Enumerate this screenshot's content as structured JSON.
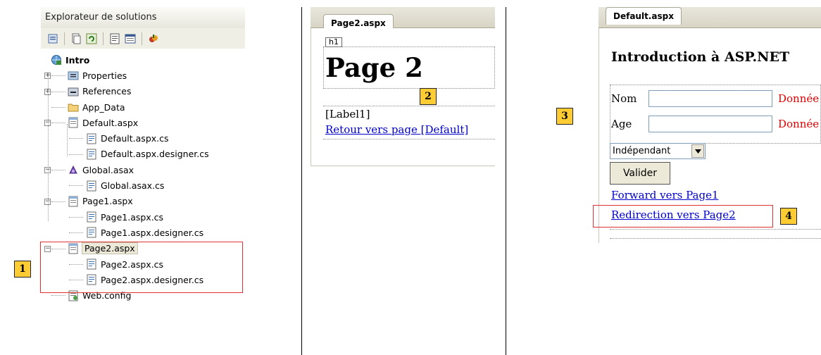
{
  "solution_explorer": {
    "title": "Explorateur de solutions",
    "toolbar_icons": [
      "properties-icon",
      "show-all-files-icon",
      "refresh-icon",
      "view-code-icon",
      "view-designer-icon",
      "class-view-icon"
    ],
    "project": "Intro",
    "items": [
      {
        "label": "Properties"
      },
      {
        "label": "References"
      },
      {
        "label": "App_Data"
      },
      {
        "label": "Default.aspx"
      },
      {
        "label": "Default.aspx.cs"
      },
      {
        "label": "Default.aspx.designer.cs"
      },
      {
        "label": "Global.asax"
      },
      {
        "label": "Global.asax.cs"
      },
      {
        "label": "Page1.aspx"
      },
      {
        "label": "Page1.aspx.cs"
      },
      {
        "label": "Page1.aspx.designer.cs"
      },
      {
        "label": "Page2.aspx"
      },
      {
        "label": "Page2.aspx.cs"
      },
      {
        "label": "Page2.aspx.designer.cs"
      },
      {
        "label": "Web.config"
      }
    ]
  },
  "callouts": [
    "1",
    "2",
    "3",
    "4"
  ],
  "page2_designer": {
    "tab": "Page2.aspx",
    "h1_tag": "h1",
    "heading": "Page 2",
    "label": "[Label1]",
    "link": "Retour vers page [Default]"
  },
  "default_designer": {
    "tab": "Default.aspx",
    "heading": "Introduction à ASP.NET",
    "nom_label": "Nom",
    "age_label": "Age",
    "error_text": "Donnée",
    "select_value": "Indépendant",
    "button": "Valider",
    "link_forward": "Forward vers Page1",
    "link_redirect": "Redirection vers Page2"
  },
  "colors": {
    "callout_fill": "#ffcc33",
    "highlight_box": "#e03030",
    "link": "#0000cc",
    "error": "#e00000"
  }
}
